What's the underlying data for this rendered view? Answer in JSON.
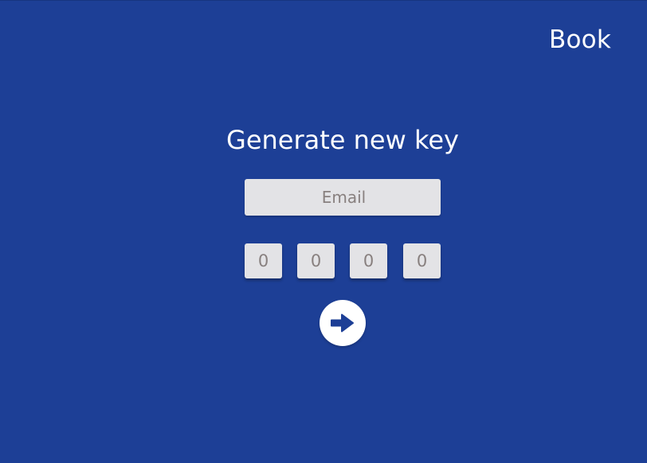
{
  "header": {
    "brand_label": "Book"
  },
  "main": {
    "title": "Generate new key",
    "email": {
      "placeholder": "Email",
      "value": ""
    },
    "code_digits": [
      {
        "placeholder": "0"
      },
      {
        "placeholder": "0"
      },
      {
        "placeholder": "0"
      },
      {
        "placeholder": "0"
      }
    ],
    "submit_icon": "arrow-right-icon"
  },
  "colors": {
    "background": "#1d3f96",
    "input_background": "#e3e3e6",
    "placeholder_text": "#88807f",
    "accent": "#1d3f96",
    "text": "#ffffff"
  }
}
